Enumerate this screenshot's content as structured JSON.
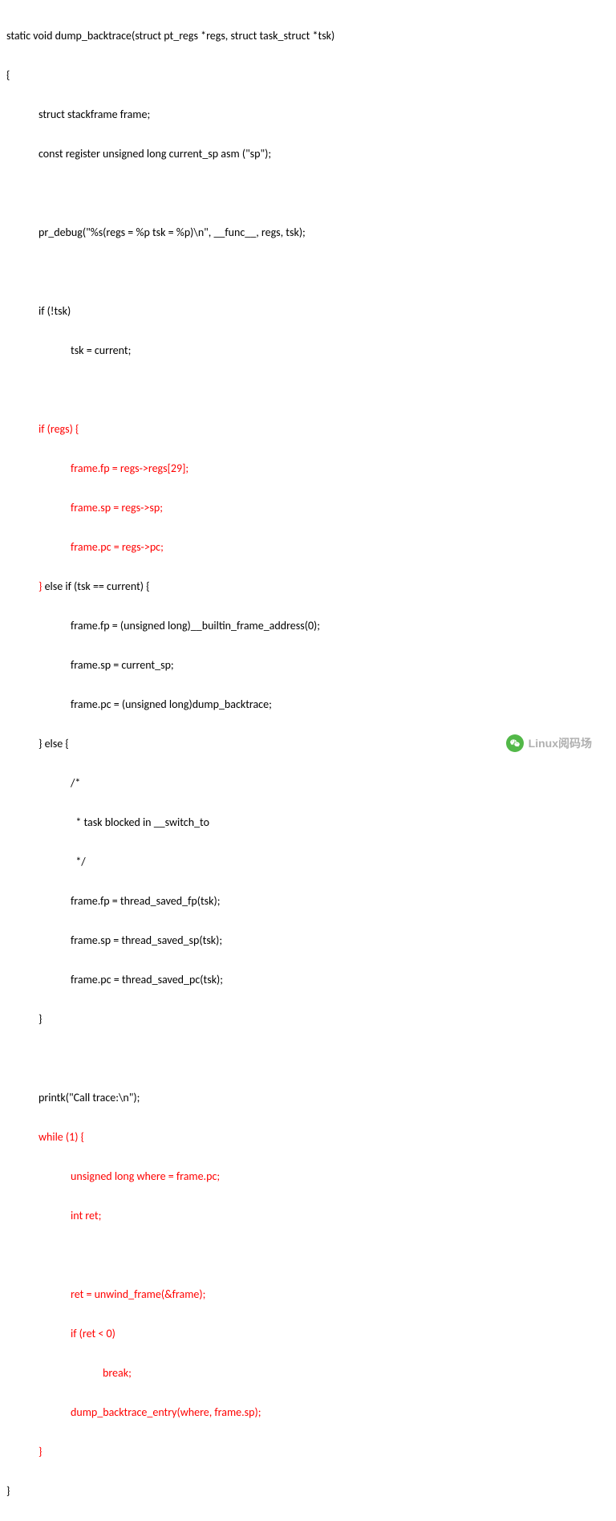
{
  "code": {
    "l1": "static void dump_backtrace(struct pt_regs *regs, struct task_struct *tsk)",
    "l2": "{",
    "l3": "struct stackframe frame;",
    "l4": "const register unsigned long current_sp asm (\"sp\");",
    "l5": "pr_debug(\"%s(regs = %p tsk = %p)\\n\", __func__, regs, tsk);",
    "l6": "if (!tsk)",
    "l7": "tsk = current;",
    "l8r": "if (regs) {",
    "l9r": "frame.fp = regs->regs[29];",
    "l10r": "frame.sp = regs->sp;",
    "l11r": "frame.pc = regs->pc;",
    "l12r": "}",
    "l12b": " else if (tsk == current) {",
    "l13": "frame.fp = (unsigned long)__builtin_frame_address(0);",
    "l14": "frame.sp = current_sp;",
    "l15": "frame.pc = (unsigned long)dump_backtrace;",
    "l16": "} else {",
    "l17": "/*",
    "l18": "  * task blocked in __switch_to",
    "l19": "  */",
    "l20": "frame.fp = thread_saved_fp(tsk);",
    "l21": "frame.sp = thread_saved_sp(tsk);",
    "l22": "frame.pc = thread_saved_pc(tsk);",
    "l23": "}",
    "l24": "printk(\"Call trace:\\n\");",
    "l25r": "while (1) {",
    "l26r": "unsigned long where = frame.pc;",
    "l27r": "int ret;",
    "l28r": "ret = unwind_frame(&frame);",
    "l29r": "if (ret < 0)",
    "l30r": "break;",
    "l31r": "dump_backtrace_entry(where, frame.sp);",
    "l32r": "}",
    "l33": "}"
  },
  "watermark": "Linux阅码场"
}
